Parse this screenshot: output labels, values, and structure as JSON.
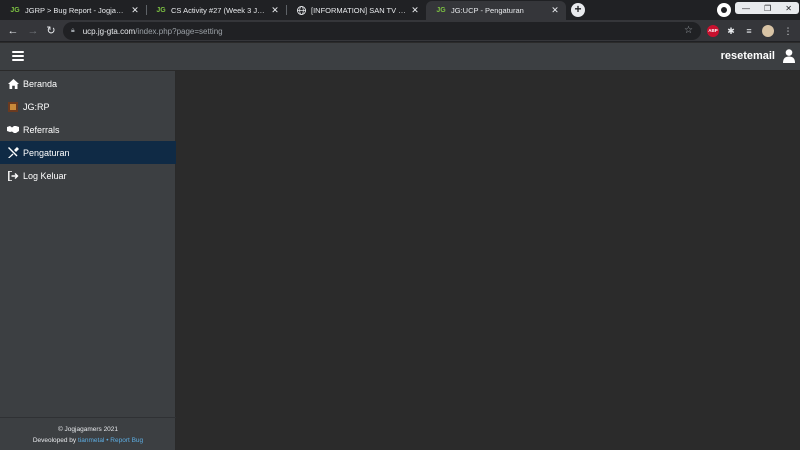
{
  "browser": {
    "tabs": [
      {
        "favicon": "JG",
        "title": "JGRP > Bug Report - Jogjagamers"
      },
      {
        "favicon": "JG",
        "title": "CS Activity #27 (Week 3 July) - P"
      },
      {
        "favicon": "globe-icon",
        "title": "[INFORMATION] SAN TV Segme"
      },
      {
        "favicon": "JG",
        "title": "JG:UCP - Pengaturan"
      }
    ],
    "new_tab": "+",
    "url_host": "ucp.jg-gta.com",
    "url_path": "/index.php?page=setting",
    "abp_label": "ABP"
  },
  "header": {
    "username": "resetemail"
  },
  "sidebar": {
    "items": [
      {
        "label": "Beranda",
        "icon": "home-icon"
      },
      {
        "label": "JG:RP",
        "icon": "jgrp-icon"
      },
      {
        "label": "Referrals",
        "icon": "handshake-icon"
      },
      {
        "label": "Pengaturan",
        "icon": "tools-icon"
      },
      {
        "label": "Log Keluar",
        "icon": "logout-icon"
      }
    ],
    "active_index": 3
  },
  "footer": {
    "copyright": "© Jogjagamers 2021",
    "developed_prefix": "Deveoloped by",
    "developer": "tianmetal",
    "separator": "•",
    "report_bug": "Report Bug"
  },
  "colors": {
    "active_item": "#0f2a45",
    "sidebar": "#3c3f42",
    "content": "#2b2b2b",
    "link": "#5dade2"
  }
}
